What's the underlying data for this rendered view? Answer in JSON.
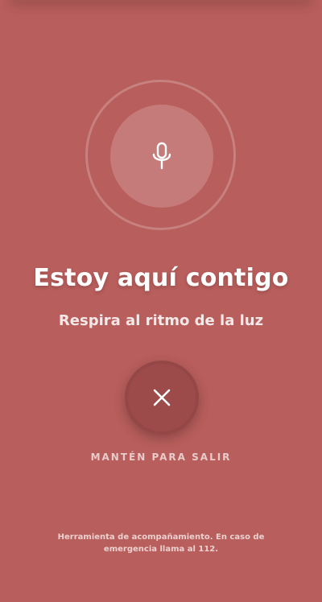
{
  "screen": {
    "background_color": "#b85e5c",
    "mic": {
      "icon": "microphone-icon"
    },
    "title": "Estoy aquí contigo",
    "subtitle": "Respira al ritmo de la luz",
    "exit_button": {
      "icon": "close-icon",
      "color": "#9c4a4a"
    },
    "hold_label": "MANTÉN PARA SALIR",
    "disclaimer": "Herramienta de acompañamiento. En caso de emergencia llama al 112."
  }
}
